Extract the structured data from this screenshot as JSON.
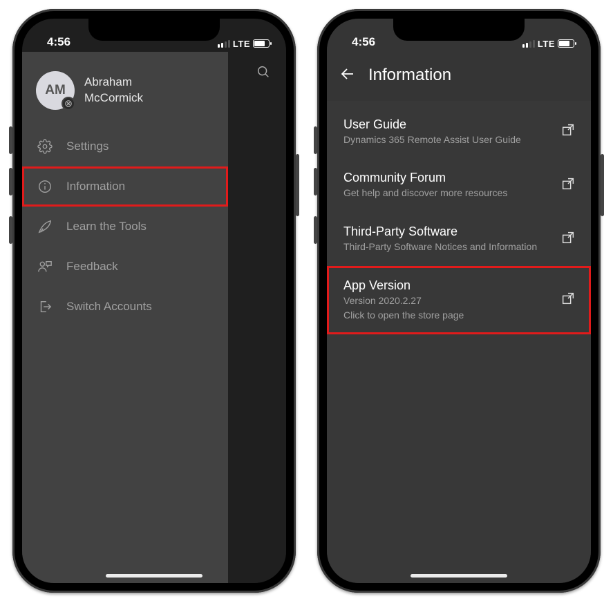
{
  "status": {
    "time": "4:56",
    "network": "LTE"
  },
  "left": {
    "avatar_initials": "AM",
    "name_first": "Abraham",
    "name_last": "McCormick",
    "menu": {
      "settings": "Settings",
      "information": "Information",
      "learn": "Learn the Tools",
      "feedback": "Feedback",
      "switch": "Switch Accounts"
    }
  },
  "right": {
    "header_title": "Information",
    "items": {
      "guide": {
        "title": "User Guide",
        "sub": "Dynamics 365 Remote Assist User Guide"
      },
      "forum": {
        "title": "Community Forum",
        "sub": "Get help and discover more resources"
      },
      "tps": {
        "title": "Third-Party Software",
        "sub": "Third-Party Software Notices and Information"
      },
      "ver": {
        "title": "App Version",
        "sub1": "Version 2020.2.27",
        "sub2": "Click to open the store page"
      }
    }
  }
}
